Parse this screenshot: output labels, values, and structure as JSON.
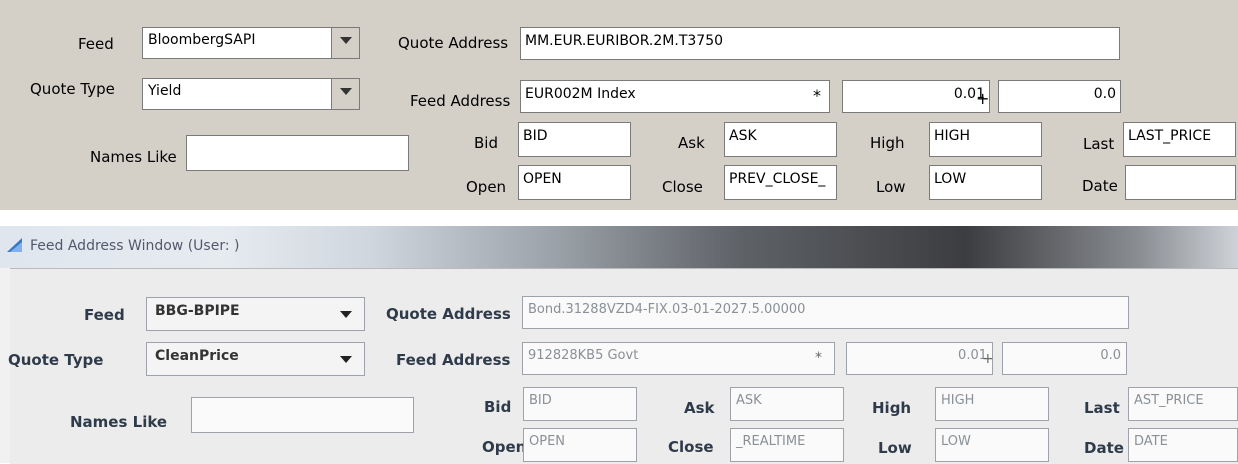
{
  "top": {
    "feed_label": "Feed",
    "feed_value": "BloombergSAPI",
    "quote_type_label": "Quote Type",
    "quote_type_value": "Yield",
    "names_like_label": "Names Like",
    "names_like_value": "",
    "quote_address_label": "Quote Address",
    "quote_address_value": "MM.EUR.EURIBOR.2M.T3750",
    "feed_address_label": "Feed Address",
    "feed_address_value": "EUR002M Index",
    "multiply_symbol": "*",
    "multiplier_value": "0.01",
    "plus_symbol": "+",
    "offset_value": "0.0",
    "bid_label": "Bid",
    "bid_value": "BID",
    "ask_label": "Ask",
    "ask_value": "ASK",
    "high_label": "High",
    "high_value": "HIGH",
    "last_label": "Last",
    "last_value": "LAST_PRICE",
    "open_label": "Open",
    "open_value": "OPEN",
    "close_label": "Close",
    "close_value": "PREV_CLOSE_",
    "low_label": "Low",
    "low_value": "LOW",
    "date_label": "Date",
    "date_value": ""
  },
  "bottom": {
    "window_title": "Feed Address Window (User: )",
    "feed_label": "Feed",
    "feed_value": "BBG-BPIPE",
    "quote_type_label": "Quote Type",
    "quote_type_value": "CleanPrice",
    "names_like_label": "Names Like",
    "names_like_value": "",
    "quote_address_label": "Quote Address",
    "quote_address_value": "Bond.31288VZD4-FIX.03-01-2027.5.00000",
    "feed_address_label": "Feed Address",
    "feed_address_value": "912828KB5 Govt",
    "multiply_symbol": "*",
    "multiplier_value": "0.01",
    "plus_symbol": "+",
    "offset_value": "0.0",
    "bid_label": "Bid",
    "bid_value": "BID",
    "ask_label": "Ask",
    "ask_value": "ASK",
    "high_label": "High",
    "high_value": "HIGH",
    "last_label": "Last",
    "last_value": "AST_PRICE",
    "open_label": "Open",
    "open_value": "OPEN",
    "close_label": "Close",
    "close_value": "_REALTIME",
    "low_label": "Low",
    "low_value": "LOW",
    "date_label": "Date",
    "date_value": "DATE"
  },
  "icons": {
    "window_icon": "feed-window-icon",
    "dropdown_icon": "chevron-down-icon"
  }
}
